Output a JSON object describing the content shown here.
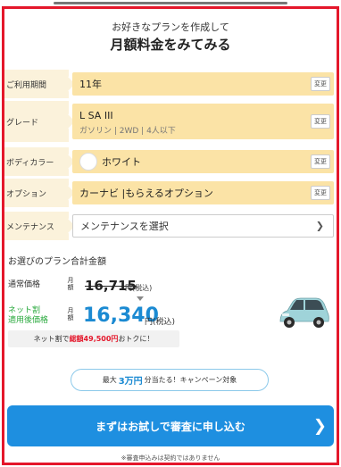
{
  "header": {
    "subtitle": "お好きなプランを作成して",
    "title": "月額料金をみてみる"
  },
  "rows": {
    "period": {
      "label": "ご利用期間",
      "value": "11年",
      "change": "変更"
    },
    "grade": {
      "label": "グレード",
      "value": "L SA III",
      "detail": "ガソリン | 2WD | 4人以下",
      "change": "変更"
    },
    "color": {
      "label": "ボディカラー",
      "value": "ホワイト",
      "change": "変更"
    },
    "option": {
      "label": "オプション",
      "value": "カーナビ |もらえるオプション",
      "change": "変更"
    },
    "maintenance": {
      "label": "メンテナンス",
      "value": "メンテナンスを選択"
    }
  },
  "pricing": {
    "section_title": "お選びのプラン合計金額",
    "regular_label": "通常価格",
    "net_label_1": "ネット割",
    "net_label_2": "適用後価格",
    "tsuki_1": "月",
    "tsuki_2": "額",
    "old_price": "16,715",
    "old_unit": "円(税込)",
    "new_price": "16,340",
    "new_unit": "円(税込)",
    "save_prefix": "ネット割で",
    "save_amount": "総額49,500円",
    "save_suffix": "おトクに！"
  },
  "campaign": {
    "prefix": "最大",
    "amount": "3万円",
    "suffix": "分当たる！キャンペーン対象"
  },
  "cta": {
    "label": "まずはお試しで審査に申し込む",
    "note": "※審査申込みは契約ではありません"
  },
  "colors": {
    "frame": "#e4172b",
    "label_bg": "#fbf2db",
    "value_bg": "#fbe3a6",
    "accent_blue": "#1b8ad2",
    "net_green": "#2baa3f",
    "cta_blue": "#1e8fe0"
  },
  "icons": {
    "cta_arrow": "chevron-right-icon",
    "maintenance_arrow": "chevron-right-icon",
    "price_arrow": "triangle-down-icon"
  }
}
